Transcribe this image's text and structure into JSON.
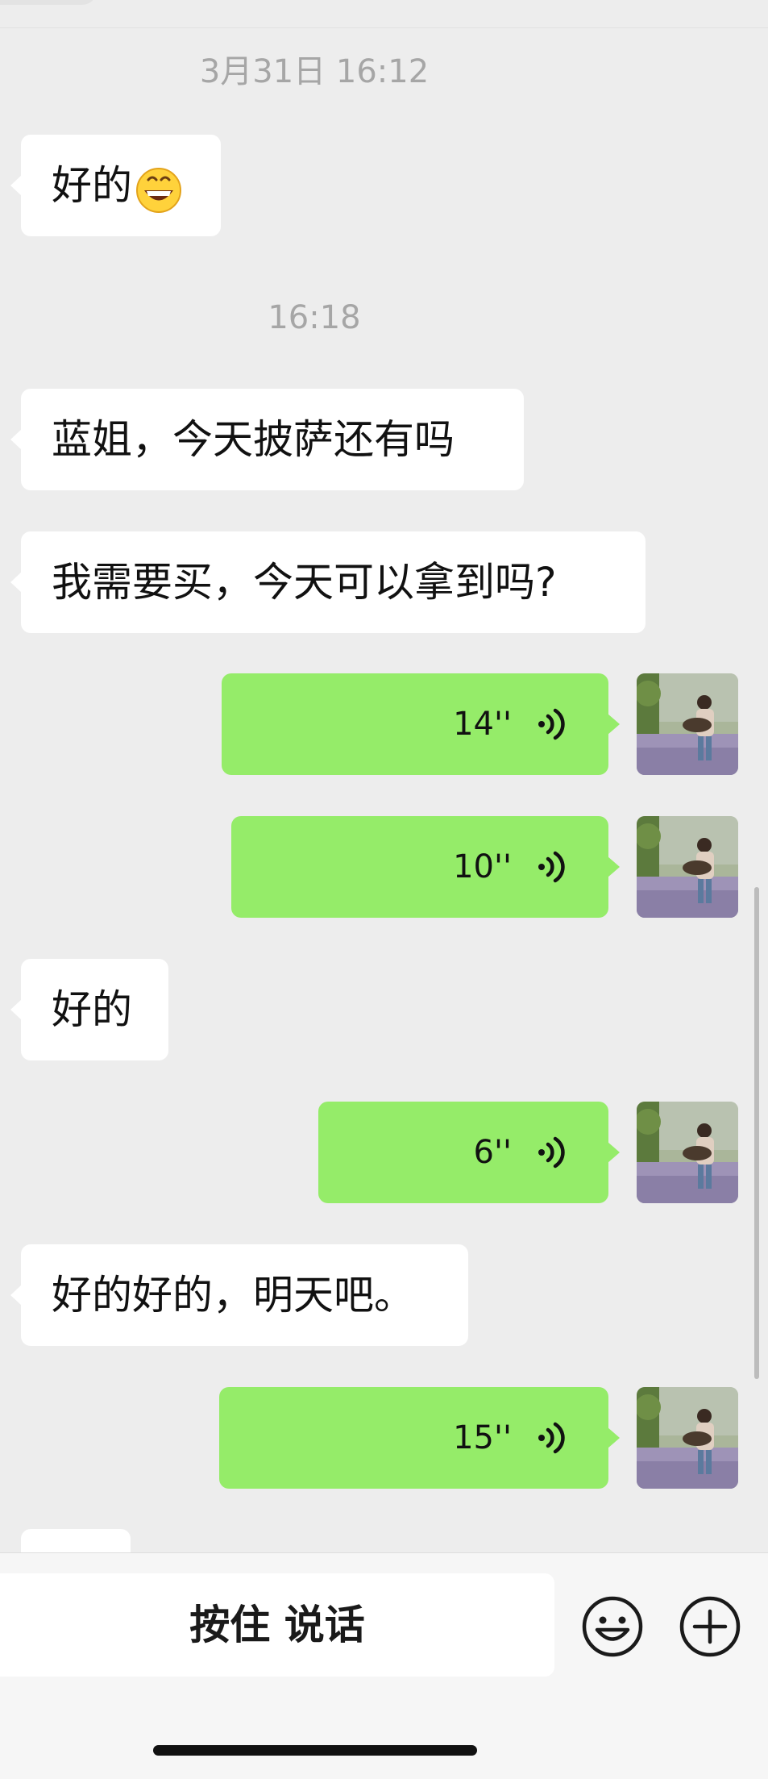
{
  "timestamps": [
    "3月31日 16:12",
    "16:18"
  ],
  "messages": [
    {
      "type": "text",
      "side": "incoming",
      "text": "好的",
      "emoji": "grinning-face-emoji"
    },
    {
      "type": "text",
      "side": "incoming",
      "text": "蓝姐，今天披萨还有吗"
    },
    {
      "type": "text",
      "side": "incoming",
      "text": "我需要买，今天可以拿到吗?"
    },
    {
      "type": "voice",
      "side": "outgoing",
      "duration": "14''"
    },
    {
      "type": "voice",
      "side": "outgoing",
      "duration": "10''"
    },
    {
      "type": "text",
      "side": "incoming",
      "text": "好的"
    },
    {
      "type": "voice",
      "side": "outgoing",
      "duration": "6''"
    },
    {
      "type": "text",
      "side": "incoming",
      "text": "好的好的，明天吧。"
    },
    {
      "type": "voice",
      "side": "outgoing",
      "duration": "15''"
    }
  ],
  "input_bar": {
    "hold_to_talk": "按住 说话",
    "emoji_icon": "smiley-icon",
    "plus_icon": "plus-icon"
  },
  "colors": {
    "background": "#ededed",
    "incoming_bubble": "#ffffff",
    "outgoing_bubble": "#95ec69",
    "timestamp": "#a6a6a6"
  }
}
